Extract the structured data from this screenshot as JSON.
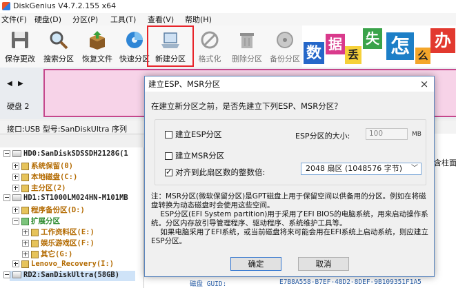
{
  "window": {
    "title": "DiskGenius V4.7.2.155 x64"
  },
  "menu": [
    "文件(F)",
    "硬盘(D)",
    "分区(P)",
    "工具(T)",
    "查看(V)",
    "帮助(H)"
  ],
  "toolbar": {
    "items": [
      {
        "label": "保存更改",
        "icon": "floppy-disk-icon"
      },
      {
        "label": "搜索分区",
        "icon": "magnifier-icon"
      },
      {
        "label": "恢复文件",
        "icon": "recover-box-icon"
      },
      {
        "label": "快速分区",
        "icon": "quick-partition-icon"
      },
      {
        "label": "新建分区",
        "icon": "laptop-disk-icon"
      },
      {
        "label": "格式化",
        "icon": "format-icon"
      },
      {
        "label": "删除分区",
        "icon": "trash-icon"
      },
      {
        "label": "备份分区",
        "icon": "backup-icon"
      }
    ]
  },
  "banner": {
    "chars": [
      "数",
      "据",
      "丢",
      "失",
      "怎",
      "么",
      "办"
    ]
  },
  "disk_panel": {
    "label": "硬盘 2"
  },
  "info_line": {
    "text": "接口:USB  型号:SanDiskUltra  序列"
  },
  "tree": {
    "items": [
      {
        "text": "HD0:SanDiskSDSSDH2128G(1",
        "kind": "disk"
      },
      {
        "text": "系统保留(0)",
        "kind": "part",
        "color": "#b36a00"
      },
      {
        "text": "本地磁盘(C:)",
        "kind": "part",
        "color": "#b36a00"
      },
      {
        "text": "主分区(2)",
        "kind": "part",
        "color": "#b36a00"
      },
      {
        "text": "HD1:ST1000LM024HN-M101MB",
        "kind": "disk"
      },
      {
        "text": "程序备份区(D:)",
        "kind": "part",
        "color": "#b36a00"
      },
      {
        "text": "扩展分区",
        "kind": "part",
        "color": "#2e8b2e"
      },
      {
        "text": "工作资料区(E:)",
        "kind": "part",
        "color": "#b36a00"
      },
      {
        "text": "娱乐游戏区(F:)",
        "kind": "part",
        "color": "#b36a00"
      },
      {
        "text": "其它(G:)",
        "kind": "part",
        "color": "#b36a00"
      },
      {
        "text": "Lenovo_Recovery(I:)",
        "kind": "part",
        "color": "#b36a00"
      },
      {
        "text": "RD2:SanDiskUltra(58GB)",
        "kind": "disk"
      }
    ]
  },
  "right_panel": {
    "guid_label": "磁盘 GUID:",
    "guid_value": "E7B8A558-B7EF-48D2-8DEF-9B109351F1A5",
    "clipped_text": "含柱面"
  },
  "dialog": {
    "title": "建立ESP、MSR分区",
    "close": "×",
    "question": "在建立新分区之前，是否先建立下列ESP、MSR分区？",
    "create_esp": {
      "label": "建立ESP分区",
      "checked": false
    },
    "create_msr": {
      "label": "建立MSR分区",
      "checked": false
    },
    "align": {
      "label": "对齐到此扇区数的整数倍:",
      "checked": true,
      "value": "2048 扇区 (1048576 字节)"
    },
    "esp_size": {
      "label": "ESP分区的大小:",
      "value": "100",
      "unit": "MB"
    },
    "note": "注：MSR分区(微软保留分区)是GPT磁盘上用于保留空间以供备用的分区。例如在将磁盘转换为动态磁盘时会使用这些空间。\n    ESP分区(EFI System partition)用于采用了EFI BIOS的电脑系统，用来启动操作系统。分区内存放引导管理程序、驱动程序、系统维护工具等。\n    如果电脑采用了EFI系统，或当前磁盘将来可能会用在EFI系统上启动系统，则应建立ESP分区。",
    "ok": "确定",
    "cancel": "取消"
  },
  "colors": {
    "highlight_box": "#e8242a",
    "dialog_border": "#5c86bd",
    "disk_block": "#f7d3e8"
  }
}
